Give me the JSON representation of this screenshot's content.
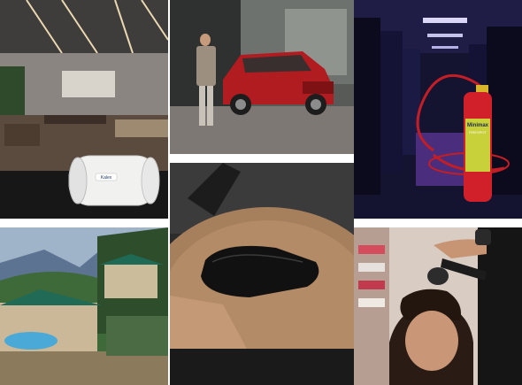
{
  "gallery": {
    "tiles": [
      {
        "id": "office-ventilation-fan"
      },
      {
        "id": "pickup-truck"
      },
      {
        "id": "server-room-fire-extinguisher",
        "brand_text": "Minimax",
        "product_text": "FIRESPOT"
      },
      {
        "id": "hillside-resort"
      },
      {
        "id": "leather-pouch"
      },
      {
        "id": "hair-salon"
      }
    ],
    "fan_brand_text": "Kalex"
  }
}
